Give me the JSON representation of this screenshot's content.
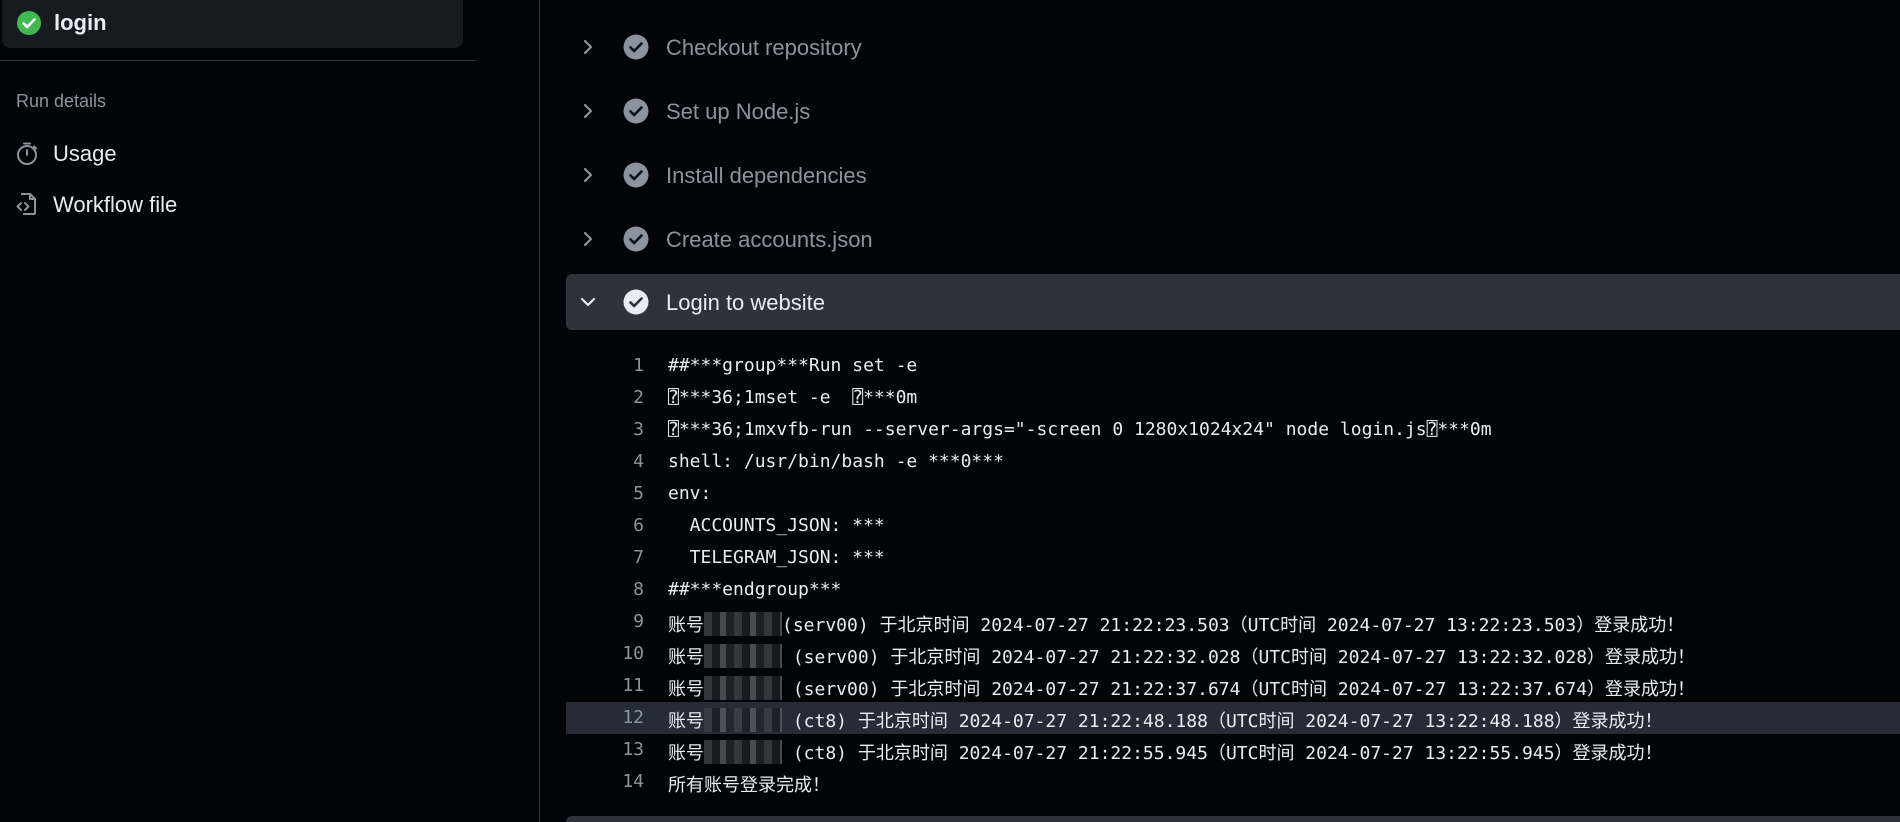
{
  "sidebar": {
    "job": {
      "label": "login",
      "status": "success"
    },
    "section_heading": "Run details",
    "items": [
      {
        "label": "Usage",
        "icon": "stopwatch-icon"
      },
      {
        "label": "Workflow file",
        "icon": "file-code-icon"
      }
    ]
  },
  "steps": [
    {
      "title": "Checkout repository",
      "expanded": false
    },
    {
      "title": "Set up Node.js",
      "expanded": false
    },
    {
      "title": "Install dependencies",
      "expanded": false
    },
    {
      "title": "Create accounts.json",
      "expanded": false
    },
    {
      "title": "Login to website",
      "expanded": true
    }
  ],
  "log": [
    {
      "num": "1",
      "text": "##***group***Run set -e"
    },
    {
      "num": "2",
      "text": "⍰***36;1mset -e  ⍰***0m"
    },
    {
      "num": "3",
      "text": "⍰***36;1mxvfb-run --server-args=\"-screen 0 1280x1024x24\" node login.js⍰***0m"
    },
    {
      "num": "4",
      "text": "shell: /usr/bin/bash -e ***0***"
    },
    {
      "num": "5",
      "text": "env:"
    },
    {
      "num": "6",
      "text": "  ACCOUNTS_JSON: ***"
    },
    {
      "num": "7",
      "text": "  TELEGRAM_JSON: ***"
    },
    {
      "num": "8",
      "text": "##***endgroup***"
    },
    {
      "num": "9",
      "prefix": "账号",
      "redacted": true,
      "text": "(serv00) 于北京时间 2024-07-27 21:22:23.503（UTC时间 2024-07-27 13:22:23.503）登录成功！"
    },
    {
      "num": "10",
      "prefix": "账号",
      "redacted": true,
      "text": " (serv00) 于北京时间 2024-07-27 21:22:32.028（UTC时间 2024-07-27 13:22:32.028）登录成功！"
    },
    {
      "num": "11",
      "prefix": "账号",
      "redacted": true,
      "text": " (serv00) 于北京时间 2024-07-27 21:22:37.674（UTC时间 2024-07-27 13:22:37.674）登录成功！"
    },
    {
      "num": "12",
      "prefix": "账号",
      "redacted": true,
      "text": " (ct8) 于北京时间 2024-07-27 21:22:48.188（UTC时间 2024-07-27 13:22:48.188）登录成功！",
      "highlight": true
    },
    {
      "num": "13",
      "prefix": "账号",
      "redacted": true,
      "text": " (ct8) 于北京时间 2024-07-27 21:22:55.945（UTC时间 2024-07-27 13:22:55.945）登录成功！"
    },
    {
      "num": "14",
      "text": "所有账号登录完成！"
    }
  ],
  "colors": {
    "success": "#3fb950",
    "step_check": "#8b949e",
    "text": "#e6edf3",
    "muted": "#8b949e"
  }
}
